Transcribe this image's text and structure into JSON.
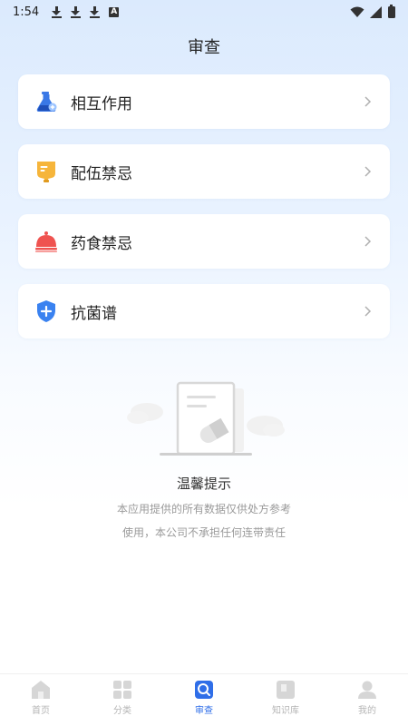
{
  "status_bar": {
    "time": "1:54"
  },
  "header": {
    "title": "审查"
  },
  "menu": [
    {
      "label": "相互作用",
      "icon": "flask-icon"
    },
    {
      "label": "配伍禁忌",
      "icon": "iv-bag-icon"
    },
    {
      "label": "药食禁忌",
      "icon": "food-cover-icon"
    },
    {
      "label": "抗菌谱",
      "icon": "shield-plus-icon"
    }
  ],
  "notice": {
    "title": "温馨提示",
    "line1": "本应用提供的所有数据仅供处方参考",
    "line2": "使用，本公司不承担任何连带责任"
  },
  "tabs": [
    {
      "label": "首页",
      "icon": "home-icon",
      "active": false
    },
    {
      "label": "分类",
      "icon": "grid-icon",
      "active": false
    },
    {
      "label": "审查",
      "icon": "search-doc-icon",
      "active": true
    },
    {
      "label": "知识库",
      "icon": "book-icon",
      "active": false
    },
    {
      "label": "我的",
      "icon": "user-icon",
      "active": false
    }
  ],
  "colors": {
    "accent": "#2f6ee8",
    "flask": "#3a78e6",
    "bag": "#f6b53b",
    "food": "#ef5350",
    "shield": "#3a82f0"
  }
}
